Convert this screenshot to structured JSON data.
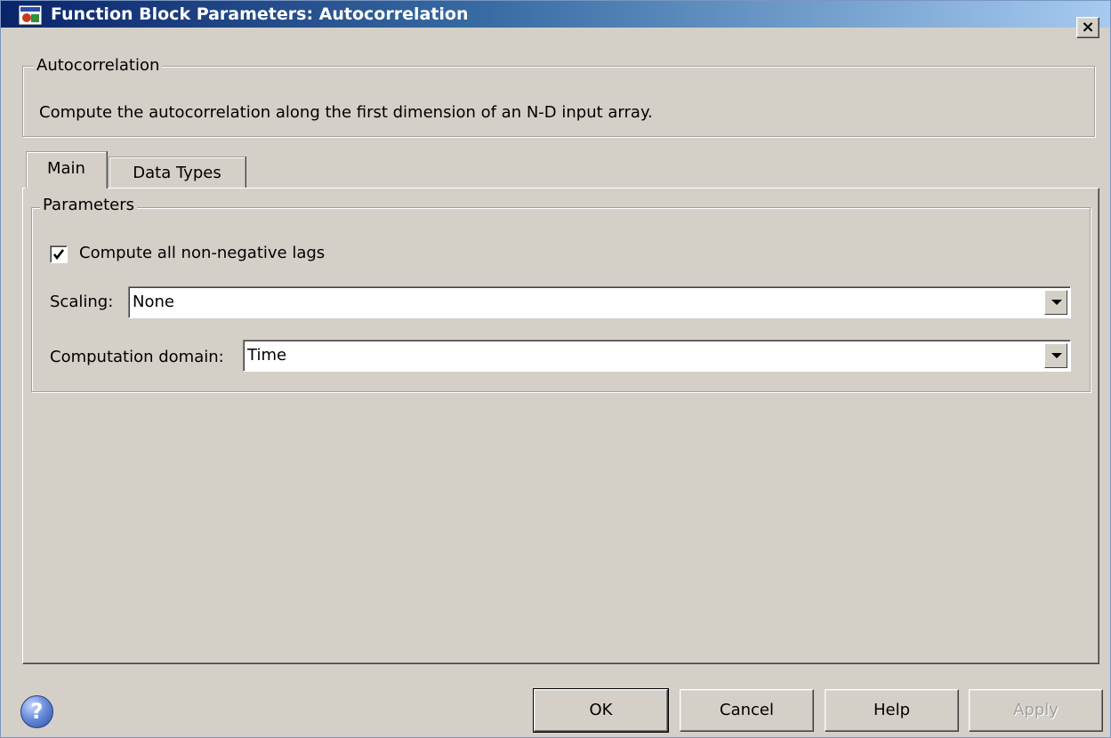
{
  "window": {
    "title": "Function Block Parameters: Autocorrelation",
    "close_label": "×"
  },
  "description": {
    "legend": "Autocorrelation",
    "text": "Compute the autocorrelation along the first dimension of an N-D input array."
  },
  "tabs": [
    {
      "label": "Main",
      "selected": true
    },
    {
      "label": "Data Types",
      "selected": false
    }
  ],
  "parameters": {
    "legend": "Parameters",
    "compute_lags": {
      "label": "Compute all non-negative lags",
      "checked": true
    },
    "scaling": {
      "label": "Scaling:",
      "value": "None"
    },
    "domain": {
      "label": "Computation domain:",
      "value": "Time"
    }
  },
  "help_icon_glyph": "?",
  "buttons": {
    "ok": "OK",
    "cancel": "Cancel",
    "help": "Help",
    "apply": "Apply"
  },
  "icons": {
    "title": "simulink-block-icon",
    "help": "help-circle-icon",
    "check": "checkmark-icon",
    "dropdown": "chevron-down-icon"
  }
}
